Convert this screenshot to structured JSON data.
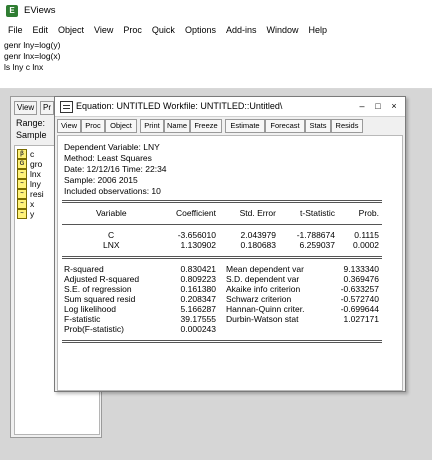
{
  "app": {
    "title": "EViews"
  },
  "menu": [
    "File",
    "Edit",
    "Object",
    "View",
    "Proc",
    "Quick",
    "Options",
    "Add-ins",
    "Window",
    "Help"
  ],
  "commands": [
    "genr lny=log(y)",
    "genr lnx=log(x)",
    "ls lny c lnx"
  ],
  "workfile": {
    "buttons": [
      "View",
      "Pr"
    ],
    "range_label": "Range:",
    "sample_label": "Sample",
    "objects": [
      {
        "label": "c",
        "icon": "coef-icon"
      },
      {
        "label": "gro",
        "icon": "group-icon"
      },
      {
        "label": "lnx",
        "icon": "series-icon"
      },
      {
        "label": "lny",
        "icon": "series-icon"
      },
      {
        "label": "resi",
        "icon": "series-icon"
      },
      {
        "label": "x",
        "icon": "series-icon"
      },
      {
        "label": "y",
        "icon": "series-icon"
      }
    ]
  },
  "equation": {
    "title": "Equation: UNTITLED   Workfile: UNTITLED::Untitled\\",
    "window_controls": [
      "–",
      "□",
      "×"
    ],
    "toolbar": [
      "View",
      "Proc",
      "Object",
      "Print",
      "Name",
      "Freeze",
      "Estimate",
      "Forecast",
      "Stats",
      "Resids"
    ],
    "header": [
      "Dependent Variable: LNY",
      "Method: Least Squares",
      "Date: 12/12/16   Time: 22:34",
      "Sample: 2006 2015",
      "Included observations: 10"
    ],
    "columns": [
      "Variable",
      "Coefficient",
      "Std. Error",
      "t-Statistic",
      "Prob."
    ],
    "rows": [
      [
        "C",
        "-3.656010",
        "2.043979",
        "-1.788674",
        "0.1115"
      ],
      [
        "LNX",
        "1.130902",
        "0.180683",
        "6.259037",
        "0.0002"
      ]
    ],
    "stats_left": [
      [
        "R-squared",
        "0.830421"
      ],
      [
        "Adjusted R-squared",
        "0.809223"
      ],
      [
        "S.E. of regression",
        "0.161380"
      ],
      [
        "Sum squared resid",
        "0.208347"
      ],
      [
        "Log likelihood",
        "5.166287"
      ],
      [
        "F-statistic",
        "39.17555"
      ],
      [
        "Prob(F-statistic)",
        "0.000243"
      ]
    ],
    "stats_right": [
      [
        "Mean dependent var",
        "9.133340"
      ],
      [
        "S.D. dependent var",
        "0.369476"
      ],
      [
        "Akaike info criterion",
        "-0.633257"
      ],
      [
        "Schwarz criterion",
        "-0.572740"
      ],
      [
        "Hannan-Quinn criter.",
        "-0.699644"
      ],
      [
        "Durbin-Watson stat",
        "1.027171"
      ]
    ]
  }
}
